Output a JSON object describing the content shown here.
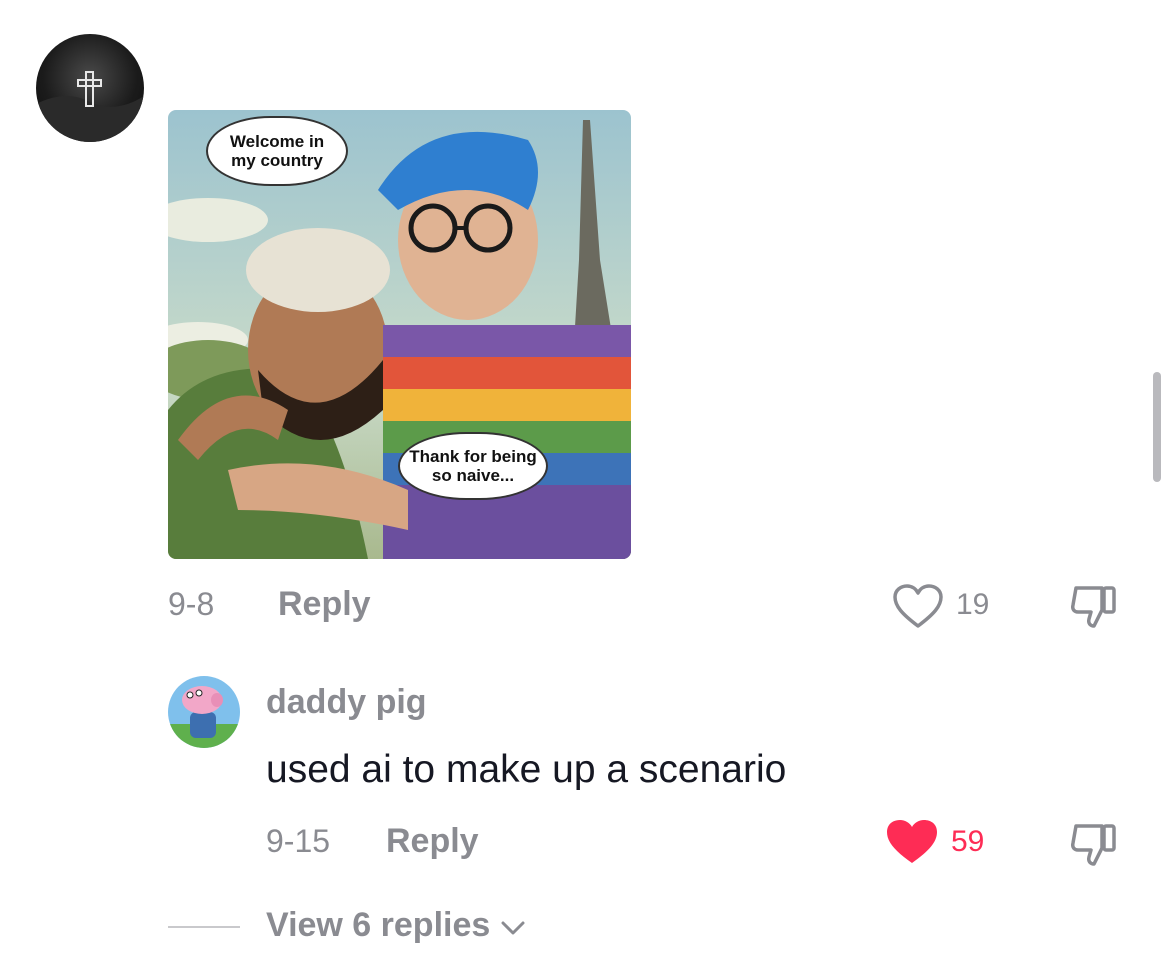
{
  "comment1": {
    "image_bubbles": {
      "top_line1": "Welcome in",
      "top_line2": "my country",
      "bottom_line1": "Thank for being",
      "bottom_line2": "so naive..."
    },
    "time": "9-8",
    "reply_label": "Reply",
    "like_count": "19",
    "liked": false
  },
  "comment2": {
    "username": "daddy pig",
    "text": "used ai to make up a scenario",
    "time": "9-15",
    "reply_label": "Reply",
    "like_count": "59",
    "liked": true
  },
  "view_replies_label": "View 6 replies",
  "colors": {
    "muted_text": "#8a8b91",
    "liked_heart": "#fe2c55"
  },
  "icons": [
    "cross-icon",
    "heart-outline-icon",
    "heart-filled-icon",
    "dislike-icon",
    "chevron-down-icon"
  ]
}
